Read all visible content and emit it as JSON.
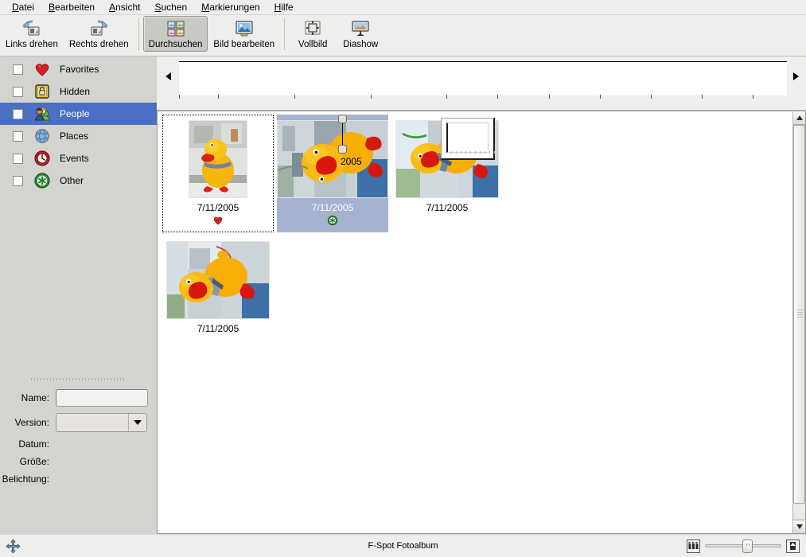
{
  "app": {
    "status_title": "F-Spot Fotoalbum"
  },
  "menubar": {
    "items": [
      {
        "label": "Datei",
        "accel": "D"
      },
      {
        "label": "Bearbeiten",
        "accel": "B"
      },
      {
        "label": "Ansicht",
        "accel": "A"
      },
      {
        "label": "Suchen",
        "accel": "S"
      },
      {
        "label": "Markierungen",
        "accel": "M"
      },
      {
        "label": "Hilfe",
        "accel": "H"
      }
    ]
  },
  "toolbar": {
    "buttons": [
      {
        "label": "Links drehen",
        "icon": "rotate-left-icon",
        "active": false
      },
      {
        "label": "Rechts drehen",
        "icon": "rotate-right-icon",
        "active": false
      },
      {
        "label": "Durchsuchen",
        "icon": "browse-icon",
        "active": true
      },
      {
        "label": "Bild bearbeiten",
        "icon": "edit-image-icon",
        "active": false
      },
      {
        "label": "Vollbild",
        "icon": "fullscreen-icon",
        "active": false
      },
      {
        "label": "Diashow",
        "icon": "slideshow-icon",
        "active": false
      }
    ]
  },
  "sidebar": {
    "tags": [
      {
        "label": "Favorites",
        "icon": "heart-icon",
        "checked": false,
        "selected": false
      },
      {
        "label": "Hidden",
        "icon": "lock-icon",
        "checked": false,
        "selected": false
      },
      {
        "label": "People",
        "icon": "people-icon",
        "checked": false,
        "selected": true
      },
      {
        "label": "Places",
        "icon": "globe-icon",
        "checked": false,
        "selected": false
      },
      {
        "label": "Events",
        "icon": "clock-icon",
        "checked": false,
        "selected": false
      },
      {
        "label": "Other",
        "icon": "asterisk-icon",
        "checked": false,
        "selected": false
      }
    ]
  },
  "info_panel": {
    "name_label": "Name:",
    "name_value": "",
    "name_placeholder": "",
    "version_label": "Version:",
    "version_value": "",
    "date_label": "Datum:",
    "date_value": "",
    "size_label": "Größe:",
    "size_value": "",
    "exposure_label": "Belichtung:",
    "exposure_value": ""
  },
  "timeline": {
    "year_label": "2005",
    "left_arrow": "◀",
    "right_arrow": "▶"
  },
  "photos": [
    {
      "date": "7/11/2005",
      "badge": "heart-icon",
      "selected": false,
      "focused": true,
      "alt": "yellow plush duck standing upright"
    },
    {
      "date": "7/11/2005",
      "badge": "asterisk-icon",
      "selected": true,
      "focused": false,
      "alt": "yellow plush duck lying on side close-up"
    },
    {
      "date": "7/11/2005",
      "badge": "",
      "selected": false,
      "focused": false,
      "alt": "yellow plush duck on side with window behind"
    },
    {
      "date": "7/11/2005",
      "badge": "",
      "selected": false,
      "focused": false,
      "alt": "two yellow plush ducks together"
    }
  ],
  "statusbar": {
    "resize_grip": "move-icon",
    "zoom_out_icon": "thumbnails-small-icon",
    "zoom_in_icon": "thumbnail-large-icon",
    "zoom_value": 55
  },
  "colors": {
    "selection_blue": "#4a6fc4",
    "cell_selection": "#a6b3d0",
    "chrome": "#eeeeec",
    "sidebar_bg": "#d3d3cf"
  }
}
